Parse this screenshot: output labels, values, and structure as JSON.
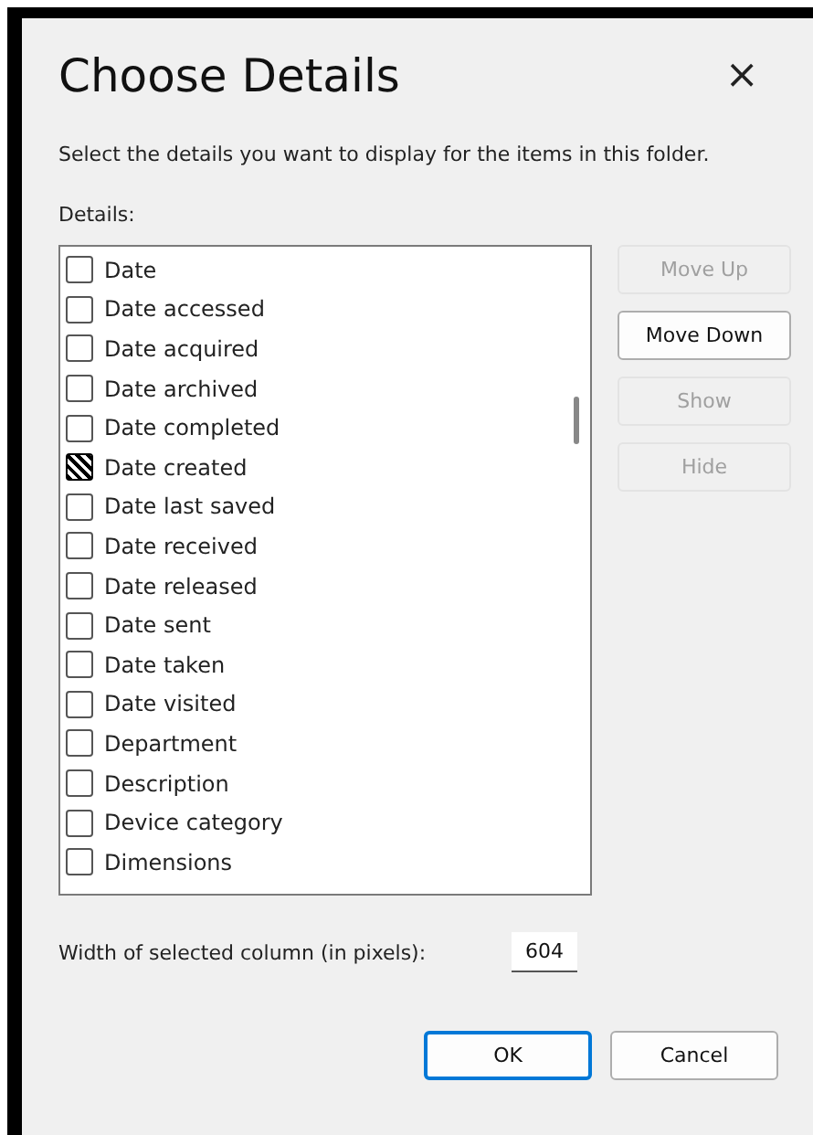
{
  "window": {
    "title": "Choose Details",
    "close": "×"
  },
  "instruction": "Select the details you want to display for the items in this folder.",
  "details_label": "Details:",
  "details": [
    {
      "label": "Date",
      "checked": false
    },
    {
      "label": "Date accessed",
      "checked": false
    },
    {
      "label": "Date acquired",
      "checked": false
    },
    {
      "label": "Date archived",
      "checked": false
    },
    {
      "label": "Date completed",
      "checked": false
    },
    {
      "label": "Date created",
      "checked": true
    },
    {
      "label": "Date last saved",
      "checked": false
    },
    {
      "label": "Date received",
      "checked": false
    },
    {
      "label": "Date released",
      "checked": false
    },
    {
      "label": "Date sent",
      "checked": false
    },
    {
      "label": "Date taken",
      "checked": false
    },
    {
      "label": "Date visited",
      "checked": false
    },
    {
      "label": "Department",
      "checked": false
    },
    {
      "label": "Description",
      "checked": false
    },
    {
      "label": "Device category",
      "checked": false
    },
    {
      "label": "Dimensions",
      "checked": false
    }
  ],
  "side_buttons": [
    {
      "label": "Move Up",
      "disabled": true
    },
    {
      "label": "Move Down",
      "disabled": false
    },
    {
      "label": "Show",
      "disabled": true
    },
    {
      "label": "Hide",
      "disabled": true
    }
  ],
  "width_field": {
    "label": "Width of selected column (in pixels):",
    "value": "604"
  },
  "buttons": [
    {
      "label": "OK",
      "default": true
    },
    {
      "label": "Cancel",
      "default": false
    }
  ]
}
